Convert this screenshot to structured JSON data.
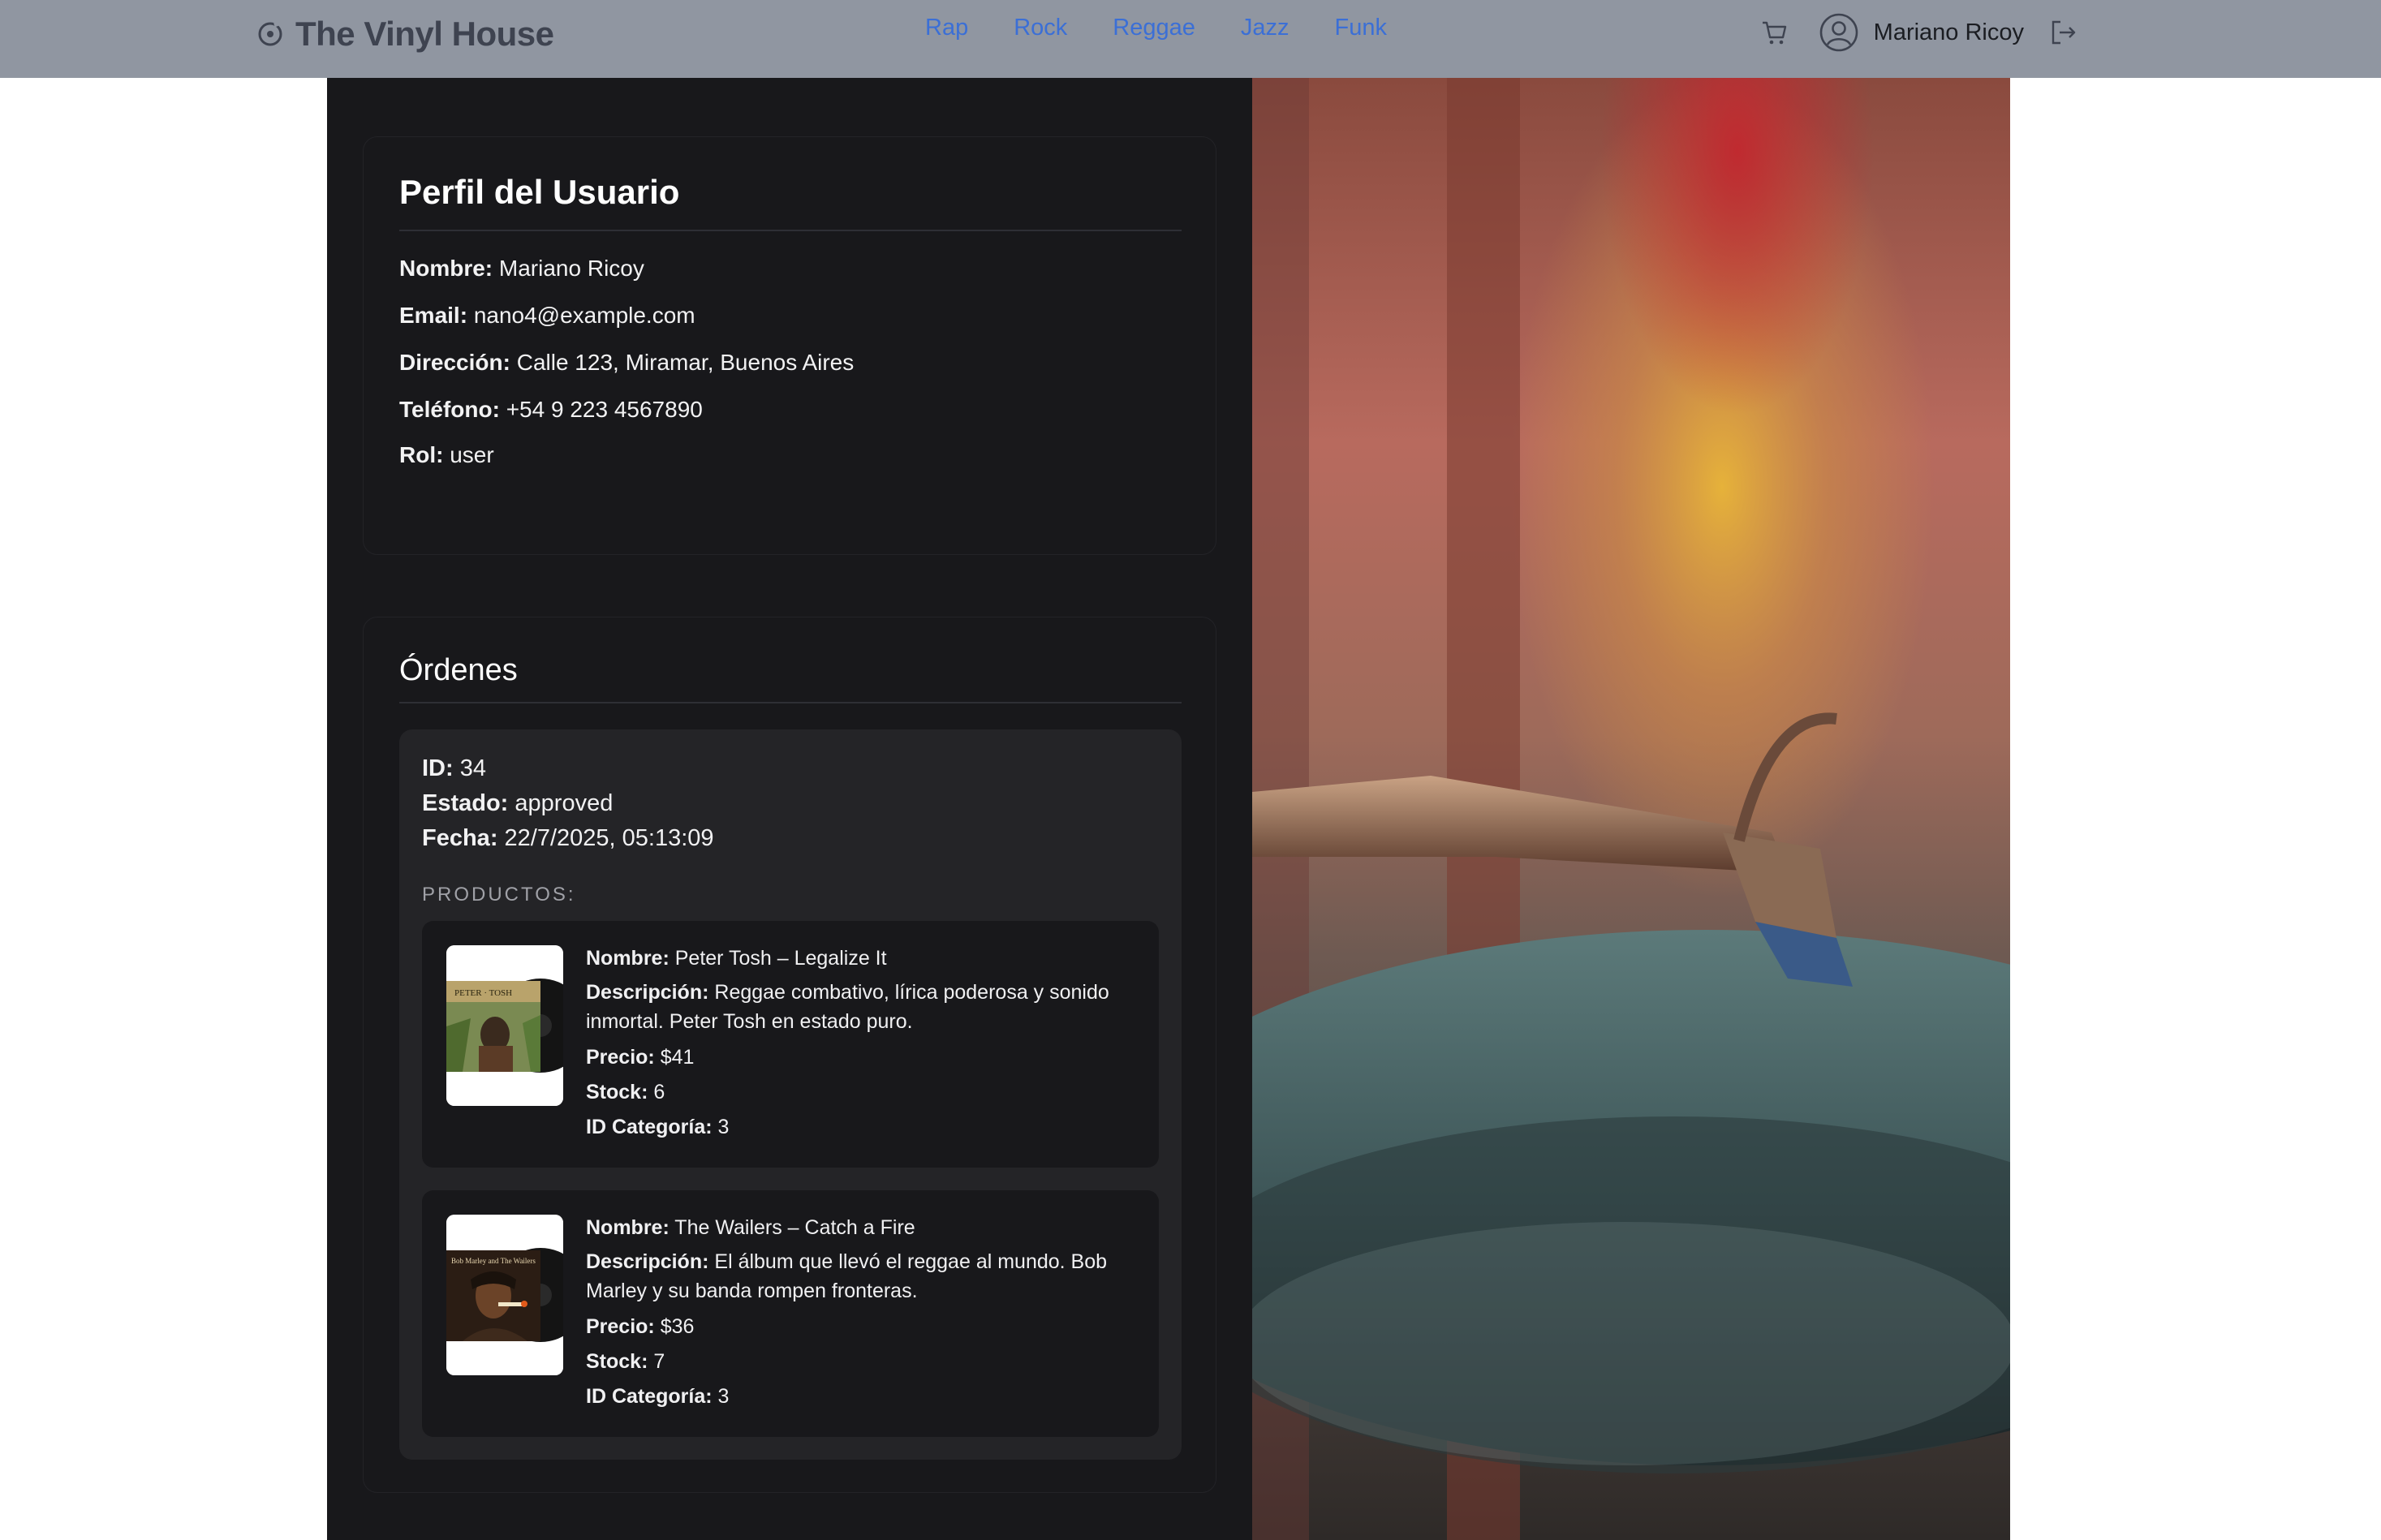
{
  "navbar": {
    "brand": "The Vinyl House",
    "brand_icon": "record-icon",
    "links": [
      "Rap",
      "Rock",
      "Reggae",
      "Jazz",
      "Funk"
    ],
    "user_name": "Mariano Ricoy",
    "colors": {
      "bar": "#9096a1",
      "link": "#3b6fd6",
      "brand": "#3e4350"
    }
  },
  "profile": {
    "title": "Perfil del Usuario",
    "fields": [
      {
        "label": "Nombre:",
        "value": "Mariano Ricoy"
      },
      {
        "label": "Email:",
        "value": "nano4@example.com"
      },
      {
        "label": "Dirección:",
        "value": "Calle 123, Miramar, Buenos Aires"
      },
      {
        "label": "Teléfono:",
        "value": "+54 9 223 4567890"
      },
      {
        "label": "Rol:",
        "value": "user"
      }
    ]
  },
  "orders": {
    "title": "Órdenes",
    "items": [
      {
        "id_label": "ID:",
        "id": "34",
        "status_label": "Estado:",
        "status": "approved",
        "date_label": "Fecha:",
        "date": "22/7/2025, 05:13:09",
        "products_label": "PRODUCTOS:",
        "products": [
          {
            "name_label": "Nombre:",
            "name": "Peter Tosh – Legalize It",
            "desc_label": "Descripción:",
            "desc_1": "Reggae combativo, lírica poderosa y sonido",
            "desc_2": "inmortal. Peter Tosh en estado puro.",
            "price_label": "Precio:",
            "price": "$41",
            "stock_label": "Stock:",
            "stock": "6",
            "cat_label": "ID Categoría:",
            "cat": "3"
          },
          {
            "name_label": "Nombre:",
            "name": "The Wailers – Catch a Fire",
            "desc_label": "Descripción:",
            "desc_1": "El álbum que llevó el reggae al mundo. Bob",
            "desc_2": "Marley y su banda rompen fronteras.",
            "price_label": "Precio:",
            "price": "$36",
            "stock_label": "Stock:",
            "stock": "7",
            "cat_label": "ID Categoría:",
            "cat": "3"
          }
        ]
      }
    ]
  },
  "theme": {
    "panel_bg": "#18181b",
    "order_bg": "#242427",
    "text": "#f2f2f3"
  }
}
